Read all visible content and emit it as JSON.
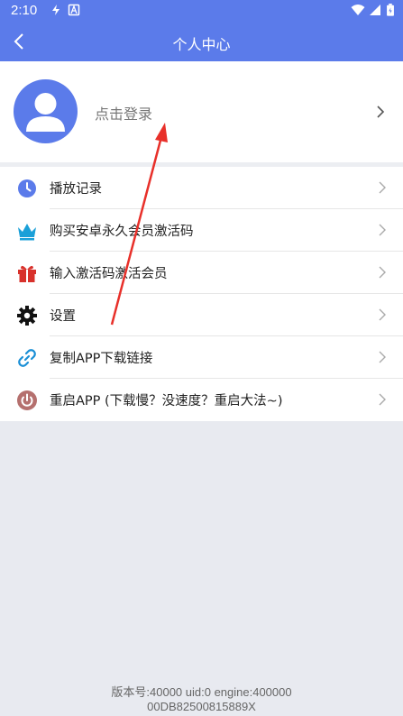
{
  "status_bar": {
    "time": "2:10"
  },
  "app_bar": {
    "title": "个人中心"
  },
  "profile": {
    "login_text": "点击登录"
  },
  "menu": {
    "items": [
      {
        "label": "播放记录",
        "icon": "clock-icon"
      },
      {
        "label": "购买安卓永久会员激活码",
        "icon": "crown-icon"
      },
      {
        "label": "输入激活码激活会员",
        "icon": "gift-icon"
      },
      {
        "label": "设置",
        "icon": "gear-icon"
      },
      {
        "label": "复制APP下载链接",
        "icon": "link-icon"
      },
      {
        "label": "重启APP (下载慢？没速度？重启大法~)",
        "icon": "power-icon"
      }
    ]
  },
  "footer": {
    "version_line1": "版本号:40000 uid:0 engine:400000",
    "version_line2": "00DB82500815889X"
  },
  "colors": {
    "primary": "#5b7bea",
    "annotation_arrow": "#e8302a"
  }
}
